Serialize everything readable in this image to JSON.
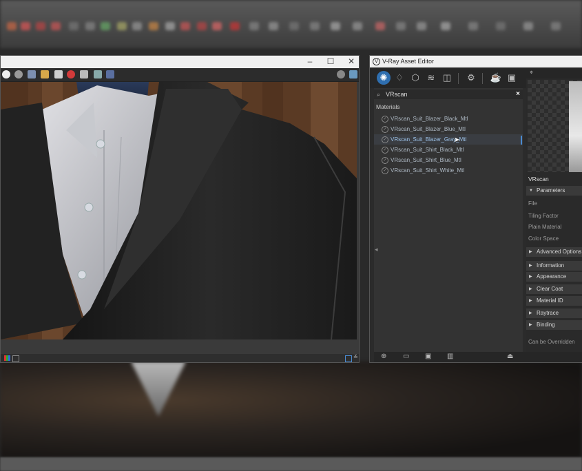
{
  "asset_editor": {
    "title": "V-Ray Asset Editor",
    "search": {
      "value": "VRscan"
    },
    "section_label": "Materials",
    "materials": [
      {
        "label": "VRscan_Suit_Blazer_Black_Mtl",
        "selected": false
      },
      {
        "label": "VRscan_Suit_Blazer_Blue_Mtl",
        "selected": false
      },
      {
        "label": "VRscan_Suit_Blazer_Gray_Mtl",
        "selected": true
      },
      {
        "label": "VRscan_Suit_Shirt_Black_Mtl",
        "selected": false
      },
      {
        "label": "VRscan_Suit_Shirt_Blue_Mtl",
        "selected": false
      },
      {
        "label": "VRscan_Suit_Shirt_White_Mtl",
        "selected": false
      }
    ],
    "properties": {
      "name": "VRscan",
      "parameters_label": "Parameters",
      "file_label": "File",
      "tiling_label": "Tiling Factor",
      "plain_label": "Plain Material",
      "color_space_label": "Color Space",
      "sections": [
        "Advanced Options",
        "Information",
        "Appearance",
        "Clear Coat",
        "Material ID",
        "Raytrace Properties",
        "Binding"
      ],
      "footer": "Can be Overridden"
    }
  },
  "colors": {
    "accent": "#2f6fb0",
    "selection_text": "#9cc2e8",
    "close_red": "#d23a3a"
  },
  "icons": {
    "toolbar": [
      "materials-icon",
      "lights-icon",
      "geometry-icon",
      "layers-icon",
      "render-elements-icon",
      "settings-icon",
      "teapot-render-icon",
      "frame-buffer-icon"
    ],
    "bottom": [
      "create-asset-icon",
      "open-folder-icon",
      "save-icon",
      "delete-icon",
      "purge-icon"
    ]
  }
}
